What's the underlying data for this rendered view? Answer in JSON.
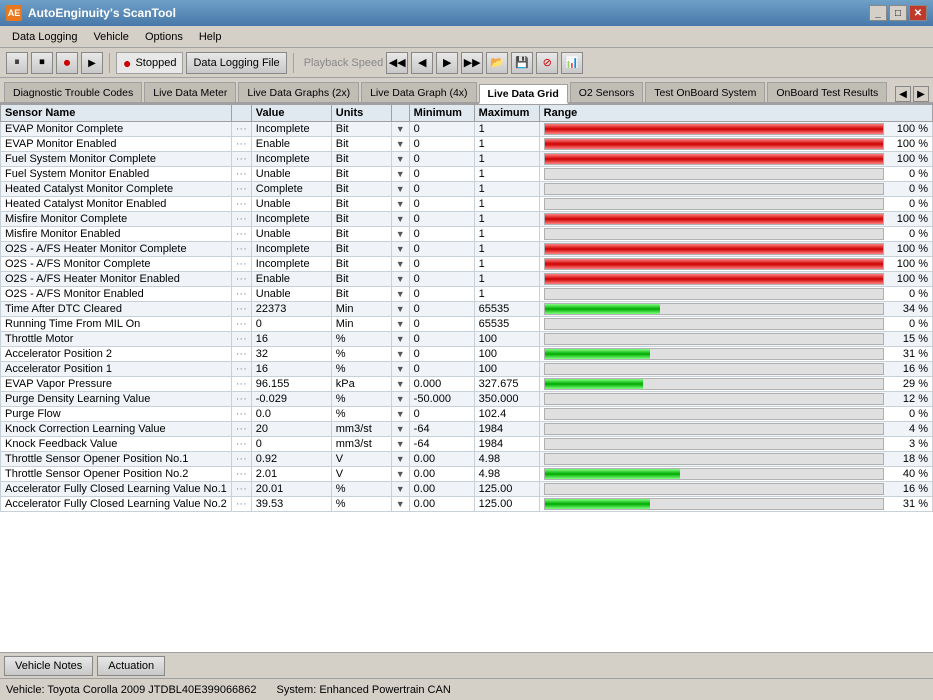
{
  "window": {
    "title": "AutoEnginuity's ScanTool",
    "icon": "AE"
  },
  "titlebar": {
    "controls": [
      "_",
      "□",
      "✕"
    ]
  },
  "menubar": {
    "items": [
      "Data Logging",
      "Vehicle",
      "Options",
      "Help"
    ]
  },
  "toolbar": {
    "stopped_label": "Stopped",
    "data_logging_file": "Data Logging File",
    "playback_speed": "Playback Speed"
  },
  "tabs": [
    {
      "label": "Diagnostic Trouble Codes",
      "active": false
    },
    {
      "label": "Live Data Meter",
      "active": false
    },
    {
      "label": "Live Data Graphs (2x)",
      "active": false
    },
    {
      "label": "Live Data Graph (4x)",
      "active": false
    },
    {
      "label": "Live Data Grid",
      "active": true
    },
    {
      "label": "O2 Sensors",
      "active": false
    },
    {
      "label": "Test OnBoard System",
      "active": false
    },
    {
      "label": "OnBoard Test Results",
      "active": false
    }
  ],
  "table": {
    "columns": [
      "Sensor Name",
      "Value",
      "Units",
      "Minimum",
      "Maximum",
      "Range"
    ],
    "rows": [
      {
        "name": "EVAP Monitor Complete",
        "value": "Incomplete",
        "units": "Bit",
        "min": "0",
        "max": "1",
        "pct": 100,
        "barColor": "red"
      },
      {
        "name": "EVAP Monitor Enabled",
        "value": "Enable",
        "units": "Bit",
        "min": "0",
        "max": "1",
        "pct": 100,
        "barColor": "red"
      },
      {
        "name": "Fuel System Monitor Complete",
        "value": "Incomplete",
        "units": "Bit",
        "min": "0",
        "max": "1",
        "pct": 100,
        "barColor": "red"
      },
      {
        "name": "Fuel System Monitor Enabled",
        "value": "Unable",
        "units": "Bit",
        "min": "0",
        "max": "1",
        "pct": 0,
        "barColor": "none"
      },
      {
        "name": "Heated Catalyst Monitor Complete",
        "value": "Complete",
        "units": "Bit",
        "min": "0",
        "max": "1",
        "pct": 0,
        "barColor": "none"
      },
      {
        "name": "Heated Catalyst Monitor Enabled",
        "value": "Unable",
        "units": "Bit",
        "min": "0",
        "max": "1",
        "pct": 0,
        "barColor": "none"
      },
      {
        "name": "Misfire Monitor Complete",
        "value": "Incomplete",
        "units": "Bit",
        "min": "0",
        "max": "1",
        "pct": 100,
        "barColor": "red"
      },
      {
        "name": "Misfire Monitor Enabled",
        "value": "Unable",
        "units": "Bit",
        "min": "0",
        "max": "1",
        "pct": 0,
        "barColor": "none"
      },
      {
        "name": "O2S - A/FS Heater Monitor Complete",
        "value": "Incomplete",
        "units": "Bit",
        "min": "0",
        "max": "1",
        "pct": 100,
        "barColor": "red"
      },
      {
        "name": "O2S - A/FS Monitor Complete",
        "value": "Incomplete",
        "units": "Bit",
        "min": "0",
        "max": "1",
        "pct": 100,
        "barColor": "red"
      },
      {
        "name": "O2S - A/FS Heater Monitor Enabled",
        "value": "Enable",
        "units": "Bit",
        "min": "0",
        "max": "1",
        "pct": 100,
        "barColor": "red"
      },
      {
        "name": "O2S - A/FS Monitor Enabled",
        "value": "Unable",
        "units": "Bit",
        "min": "0",
        "max": "1",
        "pct": 0,
        "barColor": "none"
      },
      {
        "name": "Time After DTC Cleared",
        "value": "22373",
        "units": "Min",
        "min": "0",
        "max": "65535",
        "pct": 34,
        "barColor": "green"
      },
      {
        "name": "Running Time From MIL On",
        "value": "0",
        "units": "Min",
        "min": "0",
        "max": "65535",
        "pct": 0,
        "barColor": "none"
      },
      {
        "name": "Throttle Motor",
        "value": "16",
        "units": "%",
        "min": "0",
        "max": "100",
        "pct": 15,
        "barColor": "none"
      },
      {
        "name": "Accelerator Position 2",
        "value": "32",
        "units": "%",
        "min": "0",
        "max": "100",
        "pct": 31,
        "barColor": "green"
      },
      {
        "name": "Accelerator Position 1",
        "value": "16",
        "units": "%",
        "min": "0",
        "max": "100",
        "pct": 16,
        "barColor": "none"
      },
      {
        "name": "EVAP Vapor Pressure",
        "value": "96.155",
        "units": "kPa",
        "min": "0.000",
        "max": "327.675",
        "pct": 29,
        "barColor": "green"
      },
      {
        "name": "Purge Density Learning Value",
        "value": "-0.029",
        "units": "%",
        "min": "-50.000",
        "max": "350.000",
        "pct": 12,
        "barColor": "none"
      },
      {
        "name": "Purge Flow",
        "value": "0.0",
        "units": "%",
        "min": "0",
        "max": "102.4",
        "pct": 0,
        "barColor": "none"
      },
      {
        "name": "Knock Correction Learning Value",
        "value": "20",
        "units": "mm3/st",
        "min": "-64",
        "max": "1984",
        "pct": 4,
        "barColor": "none"
      },
      {
        "name": "Knock Feedback Value",
        "value": "0",
        "units": "mm3/st",
        "min": "-64",
        "max": "1984",
        "pct": 3,
        "barColor": "none"
      },
      {
        "name": "Throttle Sensor Opener Position No.1",
        "value": "0.92",
        "units": "V",
        "min": "0.00",
        "max": "4.98",
        "pct": 18,
        "barColor": "none"
      },
      {
        "name": "Throttle Sensor Opener Position No.2",
        "value": "2.01",
        "units": "V",
        "min": "0.00",
        "max": "4.98",
        "pct": 40,
        "barColor": "green"
      },
      {
        "name": "Accelerator Fully Closed Learning Value No.1",
        "value": "20.01",
        "units": "%",
        "min": "0.00",
        "max": "125.00",
        "pct": 16,
        "barColor": "none"
      },
      {
        "name": "Accelerator Fully Closed Learning Value No.2",
        "value": "39.53",
        "units": "%",
        "min": "0.00",
        "max": "125.00",
        "pct": 31,
        "barColor": "green"
      }
    ]
  },
  "action_buttons": [
    {
      "label": "Vehicle Notes",
      "active": false
    },
    {
      "label": "Actuation",
      "active": false
    }
  ],
  "status_bar": {
    "vehicle": "Vehicle: Toyota  Corolla  2009  JTDBL40E399066862",
    "system": "System: Enhanced Powertrain CAN"
  },
  "range_suffix": "%"
}
